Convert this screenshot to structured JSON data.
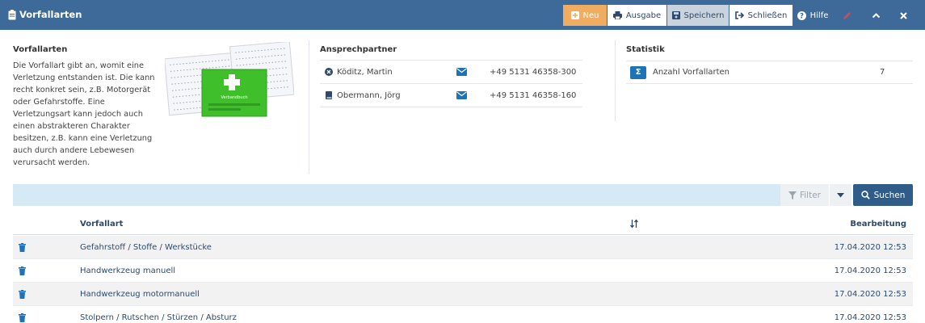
{
  "app": {
    "title": "Vorfallarten"
  },
  "toolbar": {
    "neu": "Neu",
    "ausgabe": "Ausgabe",
    "speichern": "Speichern",
    "schliessen": "Schließen",
    "hilfe": "Hilfe"
  },
  "info": {
    "title": "Vorfallarten",
    "description": "Die Vorfallart gibt an, womit eine Verletzung entstanden ist. Die kann recht konkret sein, z.B. Motorgerät oder Gefahrstoffe. Eine Verletzungsart kann jedoch auch einen abstrakteren Charakter besitzen, z.B. kann eine Verletzung auch durch andere Lebewesen verursacht werden.",
    "image_label": "Verbandbuch"
  },
  "contacts": {
    "title": "Ansprechpartner",
    "items": [
      {
        "name": "Köditz, Martin",
        "phone": "+49 5131 46358-300",
        "icon": "close-circle-icon"
      },
      {
        "name": "Obermann, Jörg",
        "phone": "+49 5131 46358-160",
        "icon": "book-icon"
      }
    ]
  },
  "stats": {
    "title": "Statistik",
    "label": "Anzahl Vorfallarten",
    "value": "7",
    "icon_glyph": "Σ"
  },
  "search": {
    "filter_label": "Filter",
    "search_label": "Suchen"
  },
  "table": {
    "col_name": "Vorfallart",
    "col_edit": "Bearbeitung",
    "rows": [
      {
        "name": "Gefahrstoff / Stoffe / Werkstücke",
        "date": "17.04.2020 12:53"
      },
      {
        "name": "Handwerkzeug manuell",
        "date": "17.04.2020 12:53"
      },
      {
        "name": "Handwerkzeug motormanuell",
        "date": "17.04.2020 12:53"
      },
      {
        "name": "Stolpern / Rutschen / Stürzen / Absturz",
        "date": "17.04.2020 12:53"
      }
    ]
  },
  "colors": {
    "header": "#3d6a98",
    "accent_orange": "#f0ad61",
    "link": "#2c4a6e",
    "icon_blue": "#1e73b8",
    "search_bar": "#d6eaf5"
  }
}
